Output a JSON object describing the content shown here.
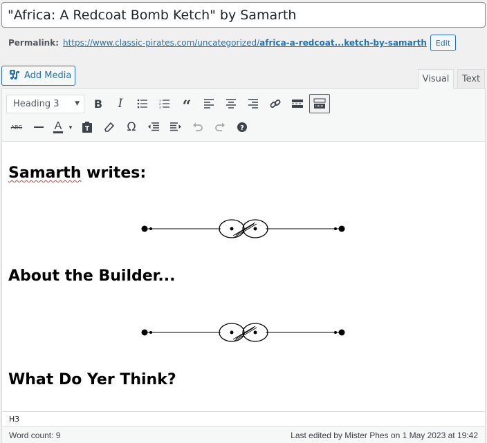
{
  "title": {
    "value": "\"Africa: A Redcoat Bomb Ketch\" by Samarth"
  },
  "permalink": {
    "label": "Permalink:",
    "url_base": "https://www.classic-pirates.com/uncategorized/",
    "url_slug": "africa-a-redcoat...ketch-by-samarth",
    "edit_label": "Edit"
  },
  "media": {
    "add_media_label": "Add Media"
  },
  "tabs": [
    {
      "label": "Visual",
      "active": true
    },
    {
      "label": "Text",
      "active": false
    }
  ],
  "toolbar": {
    "format_select": "Heading 3",
    "row1": [
      "bold",
      "italic",
      "bulleted-list",
      "numbered-list",
      "blockquote",
      "align-left",
      "align-center",
      "align-right",
      "insert-link",
      "read-more",
      "toolbar-toggle"
    ],
    "row2": [
      "strikethrough",
      "horizontal-line",
      "text-color",
      "paste-as-text",
      "clear-formatting",
      "special-character",
      "decrease-indent",
      "increase-indent",
      "undo",
      "redo",
      "keyboard-shortcuts"
    ]
  },
  "content": {
    "headings": [
      {
        "word1": "Samarth",
        "rest": " writes:"
      },
      {
        "text": "About the Builder..."
      },
      {
        "text": "What Do Yer Think?"
      }
    ]
  },
  "status": {
    "path": "H3"
  },
  "footer": {
    "word_count": "Word count: 9",
    "last_edited": "Last edited by Mister Phes on 1 May 2023 at 19:42"
  }
}
